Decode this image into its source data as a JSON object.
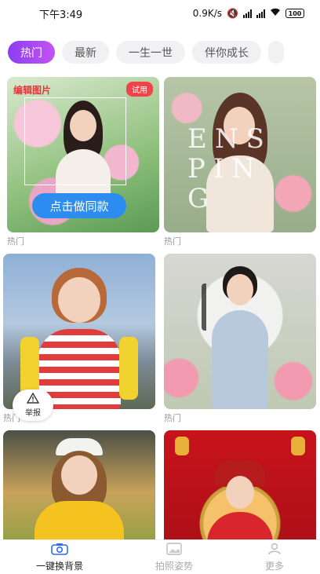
{
  "status_bar": {
    "time": "下午3:49",
    "speed": "0.9K/s",
    "battery": "100"
  },
  "tabs": [
    {
      "label": "热门",
      "active": true
    },
    {
      "label": "最新",
      "active": false
    },
    {
      "label": "一生一世",
      "active": false
    },
    {
      "label": "伴你成长",
      "active": false
    }
  ],
  "cards": [
    {
      "caption": "热门",
      "edit_label": "编辑图片",
      "badge": "试用",
      "cta": "点击做同款"
    },
    {
      "caption": "热门",
      "overlay_text": "ENSPING"
    },
    {
      "caption": "热门"
    },
    {
      "caption": "热门"
    },
    {
      "caption": ""
    },
    {
      "caption": ""
    }
  ],
  "report": {
    "label": "举报"
  },
  "bottom_nav": [
    {
      "label": "一键换背景",
      "icon": "camera-icon",
      "active": true
    },
    {
      "label": "拍照姿势",
      "icon": "image-icon",
      "active": false
    },
    {
      "label": "更多",
      "icon": "person-icon",
      "active": false
    }
  ]
}
